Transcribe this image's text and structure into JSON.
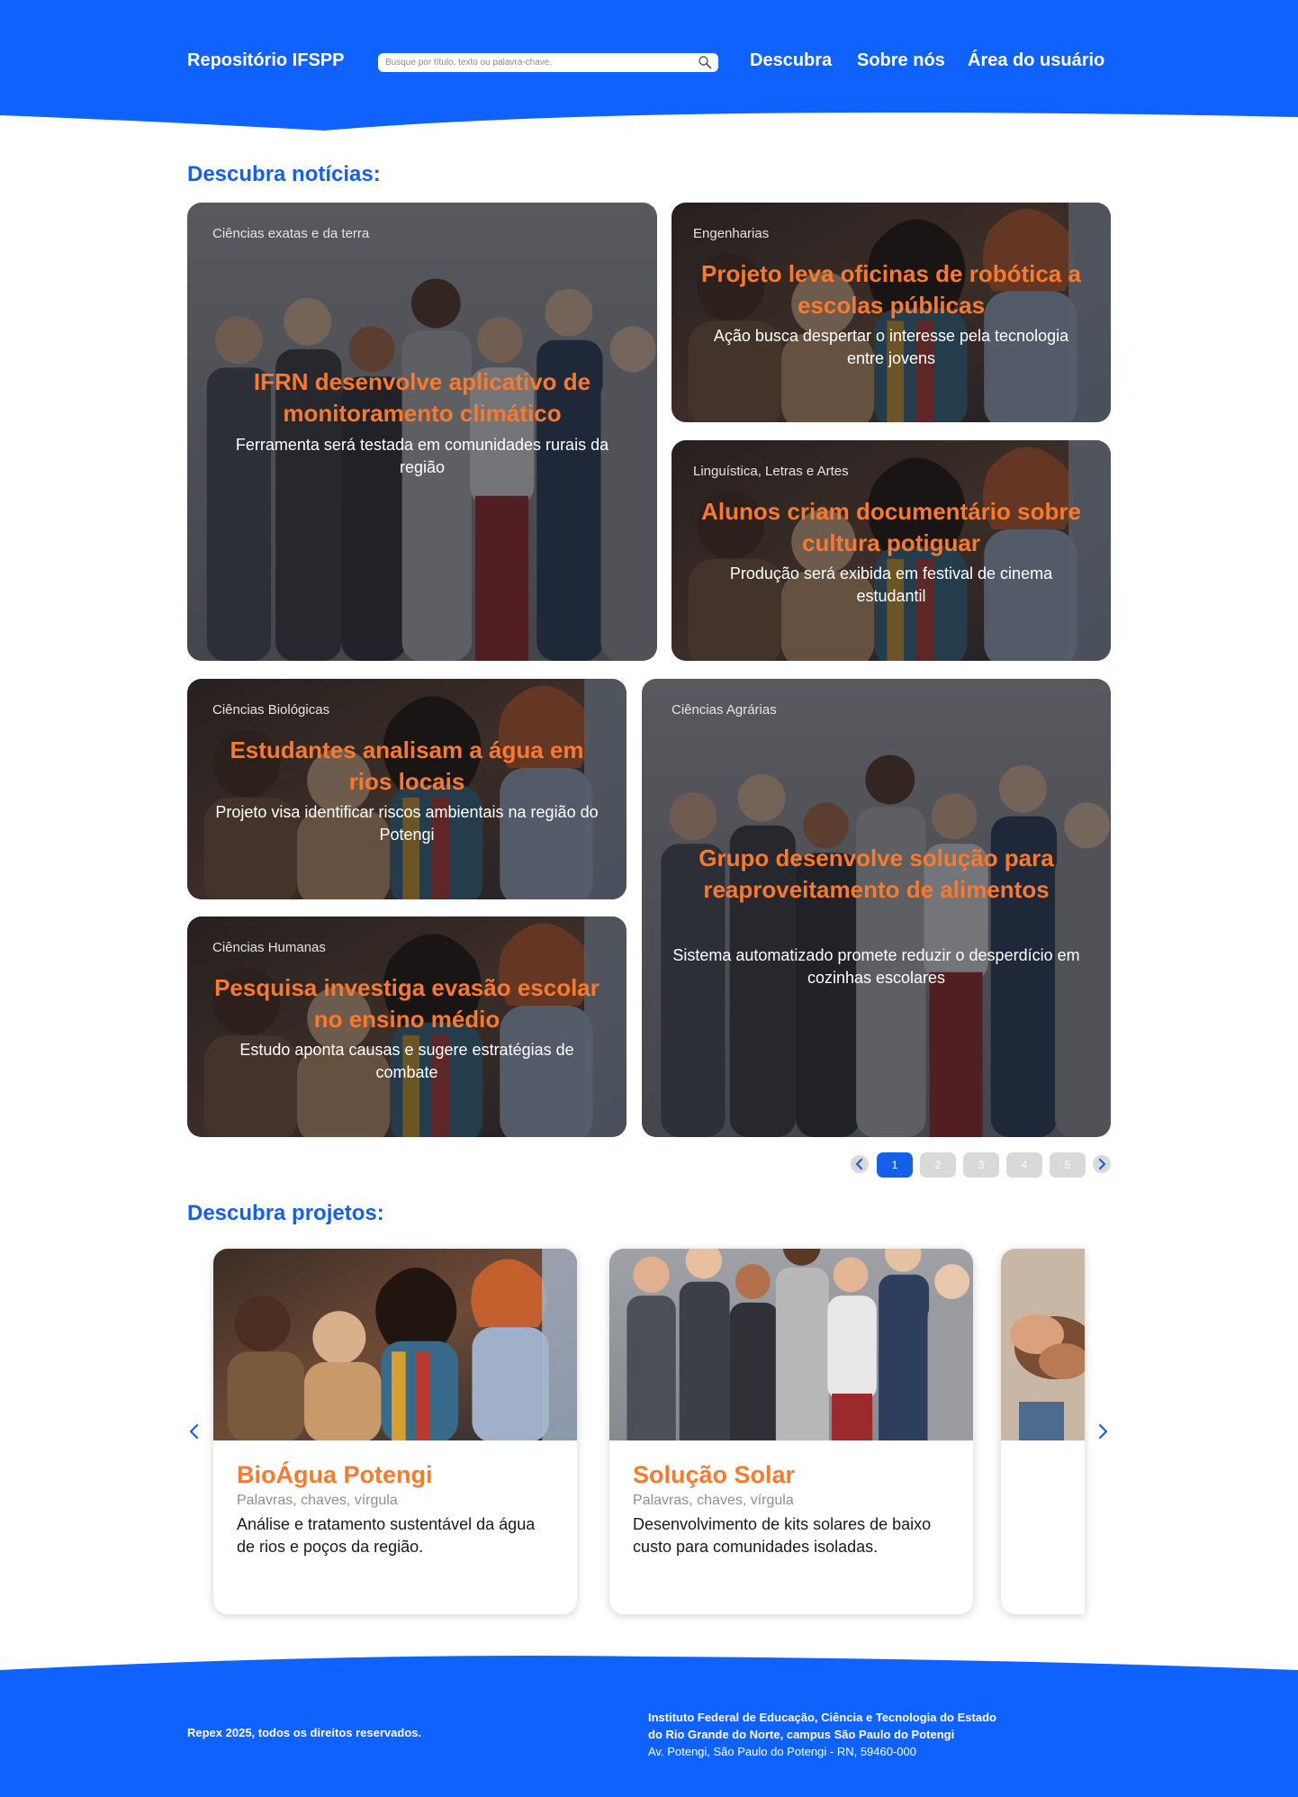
{
  "colors": {
    "primary": "#1560e8",
    "accent": "#f77a2e"
  },
  "header": {
    "brand": "Repositório IFSPP",
    "search_placeholder": "Busque por título, texto ou palavra-chave.",
    "nav": [
      "Descubra",
      "Sobre nós",
      "Área do usuário"
    ],
    "search_icon": "search-icon"
  },
  "news": {
    "title": "Descubra notícias:",
    "items": [
      {
        "category": "Ciências exatas e da terra",
        "title": "IFRN desenvolve aplicativo de monitoramento climático",
        "subtitle": "Ferramenta será testada em comunidades rurais da região"
      },
      {
        "category": "Engenharias",
        "title": "Projeto leva oficinas de robótica a escolas públicas",
        "subtitle": "Ação busca despertar o interesse pela tecnologia entre jovens"
      },
      {
        "category": "Linguística, Letras e Artes",
        "title": "Alunos criam documentário sobre cultura potiguar",
        "subtitle": "Produção será exibida em festival de cinema estudantil"
      },
      {
        "category": "Ciências Biológicas",
        "title": "Estudantes analisam a água em rios locais",
        "subtitle": "Projeto visa identificar riscos ambientais na região do Potengi"
      },
      {
        "category": "Ciências Humanas",
        "title": "Pesquisa investiga evasão escolar no ensino médio",
        "subtitle": "Estudo aponta causas e sugere estratégias de combate"
      },
      {
        "category": "Ciências Agrárias",
        "title": "Grupo desenvolve solução para reaproveitamento de alimentos",
        "subtitle": "Sistema automatizado promete reduzir o desperdício em cozinhas escolares"
      }
    ],
    "pagination": {
      "pages": [
        "1",
        "2",
        "3",
        "4",
        "5"
      ],
      "current": "1"
    }
  },
  "projects": {
    "title": "Descubra projetos:",
    "items": [
      {
        "title": "BioÁgua Potengi",
        "keywords": "Palavras, chaves, vírgula",
        "description": "Análise e tratamento sustentável da água de rios e poços da região."
      },
      {
        "title": "Solução Solar",
        "keywords": "Palavras, chaves, vírgula",
        "description": "Desenvolvimento de kits solares de baixo custo para comunidades isoladas."
      }
    ]
  },
  "footer": {
    "copyright": "Repex 2025, todos os direitos reservados.",
    "institution_line1": "Instituto Federal de Educação, Ciência e Tecnologia do Estado",
    "institution_line2": "do Rio Grande do Norte, campus São Paulo do Potengi",
    "address": "Av. Potengi, São Paulo do Potengi - RN, 59460-000"
  }
}
